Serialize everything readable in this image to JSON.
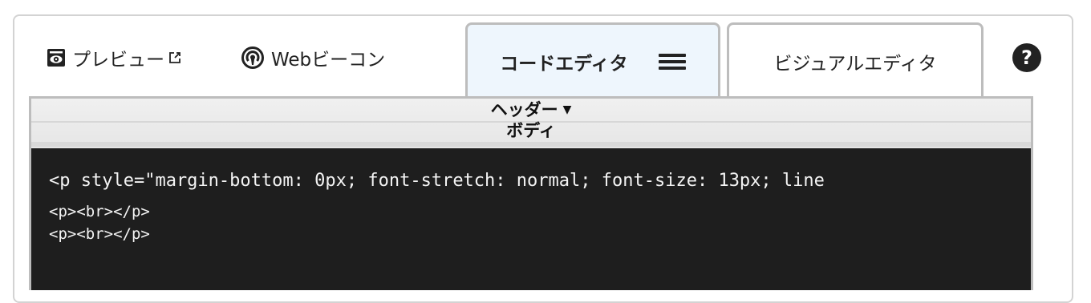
{
  "toolbar": {
    "preview_label": "プレビュー",
    "preview_icon": "eye-icon",
    "external_icon": "external-link-icon",
    "webbeacon_label": "Webビーコン",
    "webbeacon_icon": "beacon-icon"
  },
  "tabs": {
    "code_editor": "コードエディタ",
    "visual_editor": "ビジュアルエディタ",
    "menu_icon": "hamburger-menu-icon"
  },
  "help": {
    "label": "?"
  },
  "sections": {
    "header": "ヘッダー",
    "body": "ボディ"
  },
  "code": {
    "lines": [
      "<p style=\"margin-bottom: 0px; font-stretch: normal; font-size: 13px; line",
      "<p><br></p>",
      "<p><br></p>"
    ]
  },
  "colors": {
    "editor_background": "#1e1e1e",
    "editor_text": "#f4f4f4",
    "active_tab_background": "#eef6fd",
    "border": "#bdbdbd"
  }
}
